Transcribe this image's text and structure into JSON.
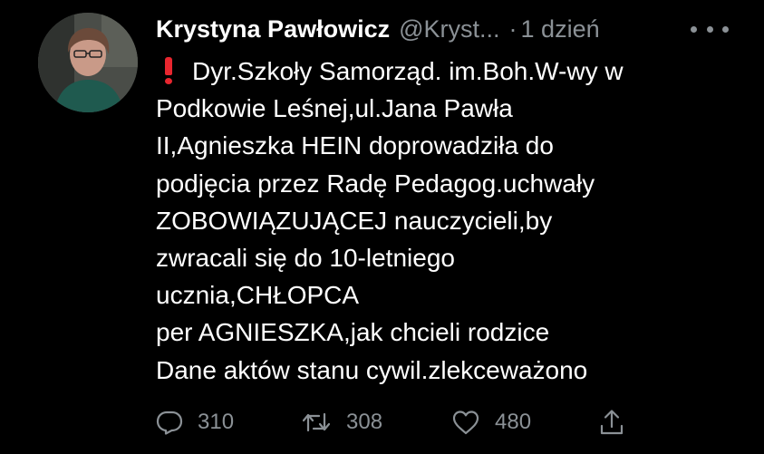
{
  "tweet": {
    "author_name": "Krystyna Pawłowicz",
    "handle": "@Kryst...",
    "separator": "·",
    "time": "1 dzień",
    "lines": [
      "Dyr.Szkoły Samorząd. im.Boh.W-wy w",
      "Podkowie Leśnej,ul.Jana Pawła",
      "II,Agnieszka HEIN doprowadziła do",
      "podjęcia przez Radę Pedagog.uchwały",
      "ZOBOWIĄZUJĄCEJ nauczycieli,by",
      "zwracali się do 10-letniego",
      "ucznia,CHŁOPCA",
      "per AGNIESZKA,jak chcieli rodzice",
      "Dane aktów stanu cywil.zlekceważono"
    ],
    "leading_icon": "exclamation-icon"
  },
  "actions": {
    "reply_count": "310",
    "retweet_count": "308",
    "like_count": "480"
  },
  "colors": {
    "background": "#000000",
    "text": "#ffffff",
    "secondary": "#8b9196",
    "alert": "#e8262f"
  }
}
